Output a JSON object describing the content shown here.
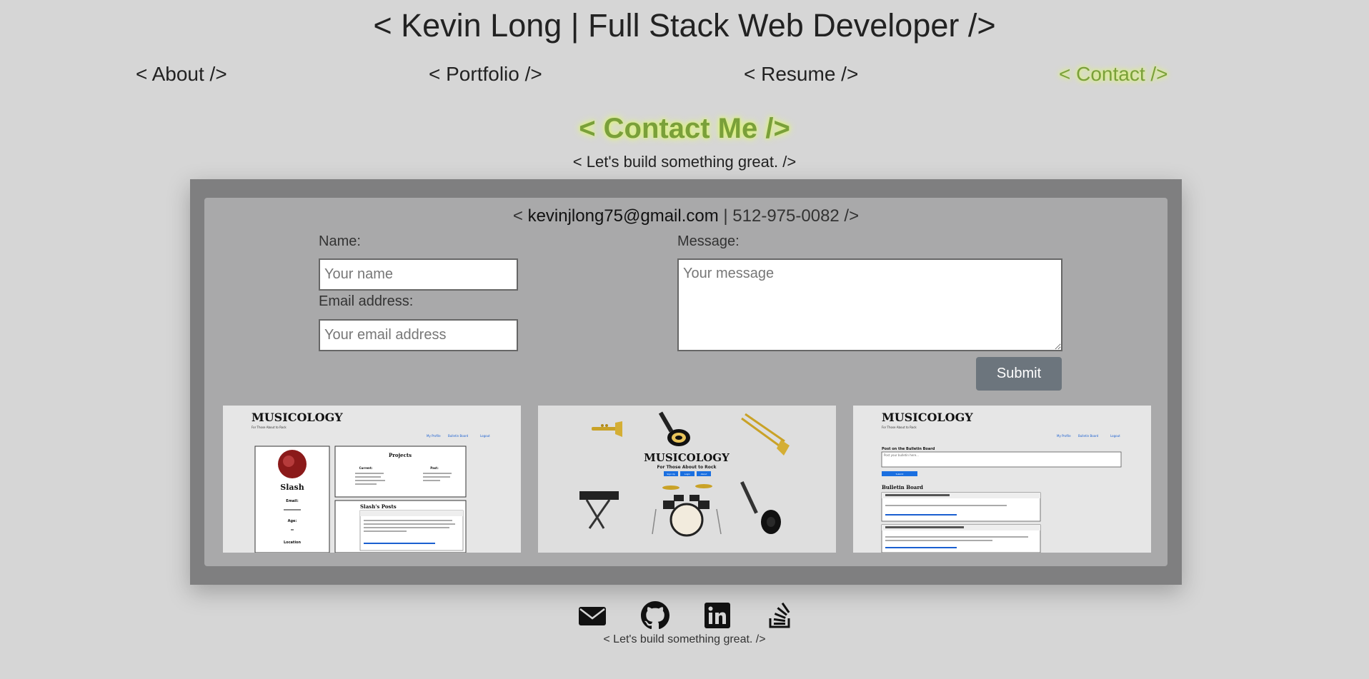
{
  "header": {
    "title": "< Kevin Long | Full Stack Web Developer />"
  },
  "nav": {
    "items": [
      {
        "label": "< About />",
        "active": false
      },
      {
        "label": "< Portfolio />",
        "active": false
      },
      {
        "label": "< Resume />",
        "active": false
      },
      {
        "label": "< Contact />",
        "active": true
      }
    ],
    "active_color": "#7aa03a"
  },
  "contact": {
    "title": "< Contact Me />",
    "subtitle": "< Let's build something great. />",
    "line_prefix": "< ",
    "email": "kevinjlong75@gmail.com",
    "separator": " | ",
    "phone": "512-975-0082",
    "line_suffix": " />"
  },
  "form": {
    "name_label": "Name:",
    "name_placeholder": "Your name",
    "email_label": "Email address:",
    "email_placeholder": "Your email address",
    "message_label": "Message:",
    "message_placeholder": "Your message",
    "submit_label": "Submit",
    "submit_color": "#6c757d"
  },
  "screenshots": {
    "brand": "MUSICOLOGY",
    "tagline": "For Those About to Rock",
    "nav_links": [
      "My Profile",
      "Bulletin Board",
      "Logout"
    ],
    "profile": {
      "name": "Slash",
      "fields": [
        "Email:",
        "Age:",
        "Location"
      ],
      "projects_title": "Projects",
      "current_label": "Current:",
      "past_label": "Past:",
      "posts_title": "Slash's Posts"
    },
    "landing_buttons": [
      "Sign Up",
      "Login",
      "About"
    ],
    "bulletin": {
      "post_title": "Post on the Bulletin Board",
      "post_placeholder": "Post your bulletin here...",
      "post_button": "Submit",
      "board_title": "Bulletin Board"
    }
  },
  "footer": {
    "icons": [
      "envelope-icon",
      "github-icon",
      "linkedin-icon",
      "stackoverflow-icon"
    ],
    "text": "< Let's build something great. />"
  }
}
